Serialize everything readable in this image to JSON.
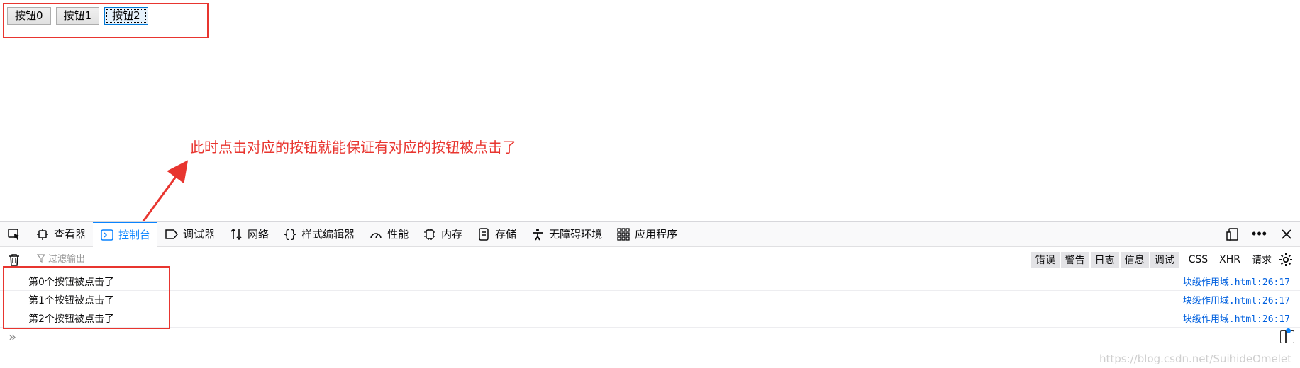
{
  "page": {
    "buttons": [
      "按钮0",
      "按钮1",
      "按钮2"
    ],
    "annotation": "此时点击对应的按钮就能保证有对应的按钮被点击了",
    "annotation_color": "#e8352f"
  },
  "devtools": {
    "tabs": [
      {
        "label": "查看器",
        "icon": "inspector-icon"
      },
      {
        "label": "控制台",
        "icon": "console-icon",
        "active": true
      },
      {
        "label": "调试器",
        "icon": "debugger-icon"
      },
      {
        "label": "网络",
        "icon": "network-icon"
      },
      {
        "label": "样式编辑器",
        "icon": "style-editor-icon"
      },
      {
        "label": "性能",
        "icon": "performance-icon"
      },
      {
        "label": "内存",
        "icon": "memory-icon"
      },
      {
        "label": "存储",
        "icon": "storage-icon"
      },
      {
        "label": "无障碍环境",
        "icon": "accessibility-icon"
      },
      {
        "label": "应用程序",
        "icon": "application-icon"
      }
    ],
    "filter_placeholder": "过滤输出",
    "levels": [
      "错误",
      "警告",
      "日志",
      "信息",
      "调试"
    ],
    "types": [
      "CSS",
      "XHR",
      "请求"
    ],
    "logs": [
      {
        "message": "第0个按钮被点击了",
        "source": "块级作用域.html:26:17"
      },
      {
        "message": "第1个按钮被点击了",
        "source": "块级作用域.html:26:17"
      },
      {
        "message": "第2个按钮被点击了",
        "source": "块级作用域.html:26:17"
      }
    ],
    "accent_color": "#0a84ff"
  },
  "watermark": "https://blog.csdn.net/SuihideOmelet"
}
